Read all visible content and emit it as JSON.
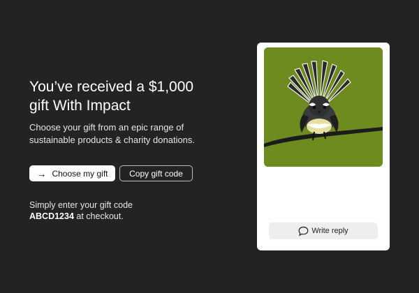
{
  "hero": {
    "headline_line1": "You’ve received a $1,000",
    "headline_line2": "gift With Impact",
    "subtitle_line1": "Choose your gift from an epic range of",
    "subtitle_line2": "sustainable products & charity donations."
  },
  "actions": {
    "choose_arrow": "→",
    "choose_label": "Choose my gift",
    "copy_label": "Copy gift code"
  },
  "instructions": {
    "line1": "Simply enter your gift code",
    "code": "ABCD1234",
    "line2_suffix": " at checkout."
  },
  "card": {
    "image_alt": "Fantail bird illustration",
    "image_background": "#6e8b1f",
    "reply_icon": "speech-bubble-icon",
    "reply_label": "Write reply"
  },
  "colors": {
    "page_background": "#232323",
    "card_background": "#ffffff",
    "reply_background": "#eeeeee"
  }
}
